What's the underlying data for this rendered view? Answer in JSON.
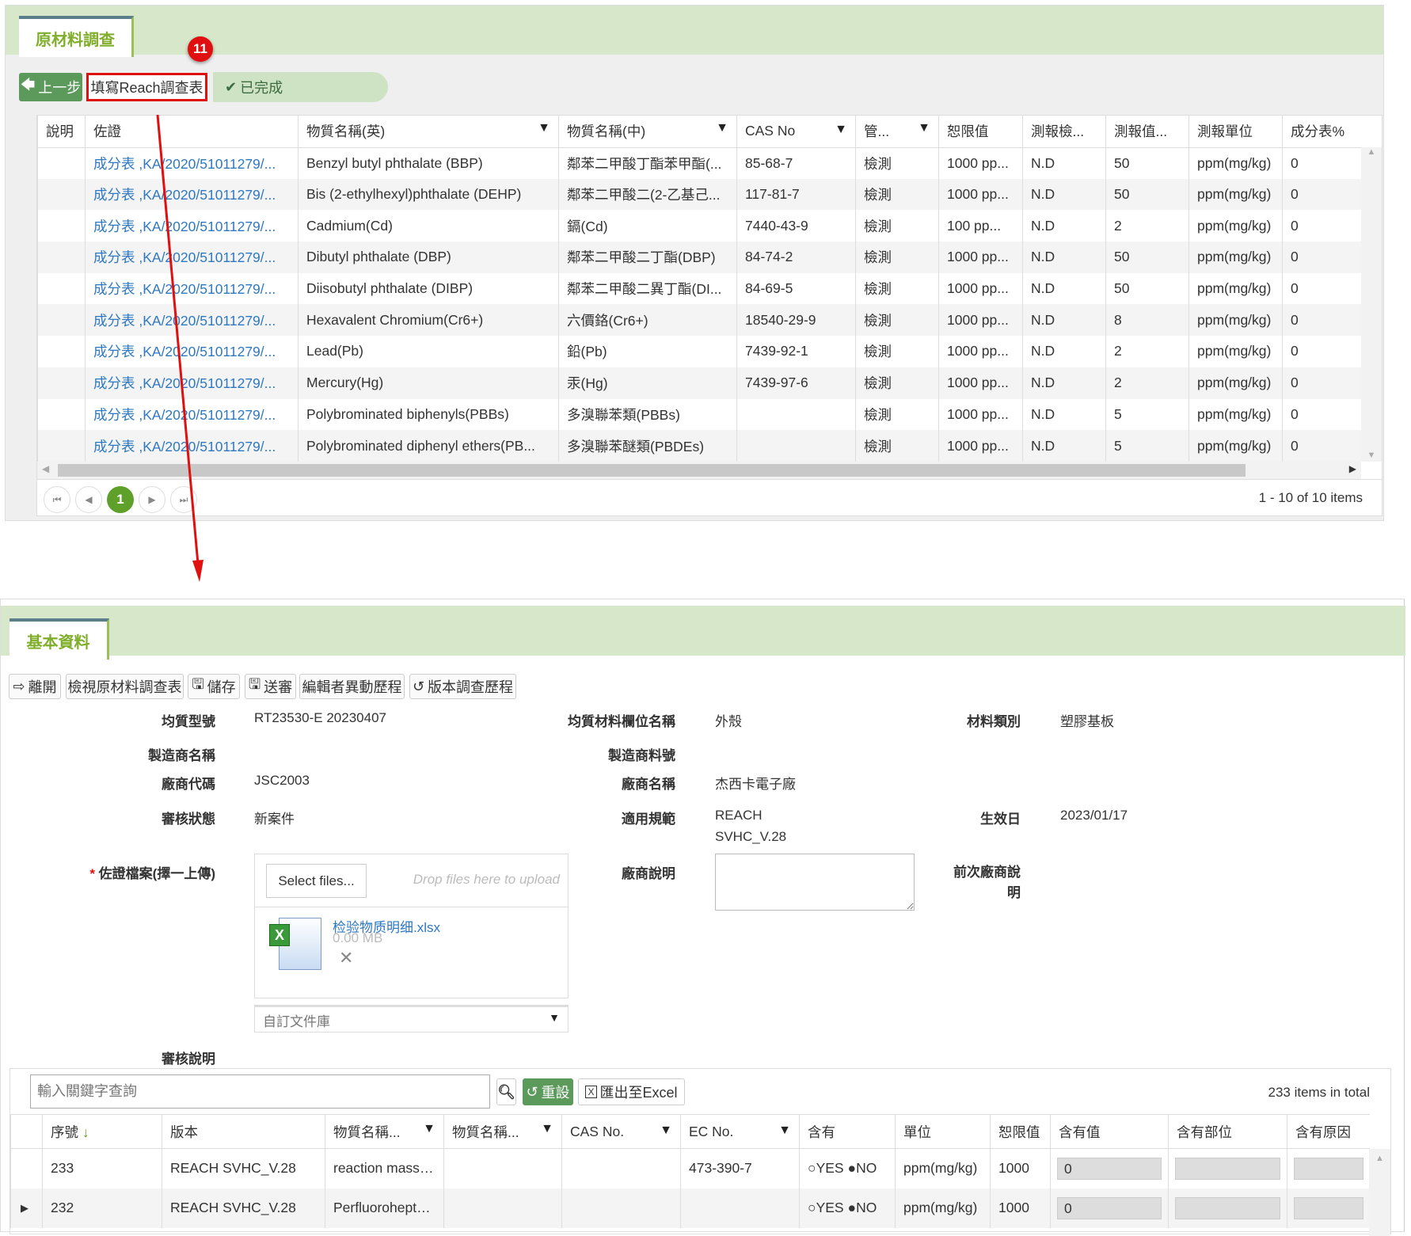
{
  "top": {
    "tab": "原材料調查",
    "badge": "11",
    "back_label": "上一步",
    "fill_label": "填寫Reach調查表",
    "done_label": "已完成",
    "columns": [
      "說明",
      "佐證",
      "物質名稱(英)",
      "物質名稱(中)",
      "CAS No",
      "管...",
      "恕限值",
      "測報檢...",
      "測報值...",
      "測報單位",
      "成分表%"
    ],
    "rows": [
      [
        "",
        "成分表 ,KA/2020/51011279/...",
        "Benzyl butyl phthalate (BBP)",
        "鄰苯二甲酸丁酯苯甲酯(...",
        "85-68-7",
        "檢測",
        "1000 pp...",
        "N.D",
        "50",
        "ppm(mg/kg)",
        "0"
      ],
      [
        "",
        "成分表 ,KA/2020/51011279/...",
        "Bis (2-ethylhexyl)phthalate (DEHP)",
        "鄰苯二甲酸二(2-乙基己...",
        "117-81-7",
        "檢測",
        "1000 pp...",
        "N.D",
        "50",
        "ppm(mg/kg)",
        "0"
      ],
      [
        "",
        "成分表 ,KA/2020/51011279/...",
        "Cadmium(Cd)",
        "鎘(Cd)",
        "7440-43-9",
        "檢測",
        "100 pp...",
        "N.D",
        "2",
        "ppm(mg/kg)",
        "0"
      ],
      [
        "",
        "成分表 ,KA/2020/51011279/...",
        "Dibutyl phthalate (DBP)",
        "鄰苯二甲酸二丁酯(DBP)",
        "84-74-2",
        "檢測",
        "1000 pp...",
        "N.D",
        "50",
        "ppm(mg/kg)",
        "0"
      ],
      [
        "",
        "成分表 ,KA/2020/51011279/...",
        "Diisobutyl phthalate (DIBP)",
        "鄰苯二甲酸二異丁酯(DI...",
        "84-69-5",
        "檢測",
        "1000 pp...",
        "N.D",
        "50",
        "ppm(mg/kg)",
        "0"
      ],
      [
        "",
        "成分表 ,KA/2020/51011279/...",
        "Hexavalent Chromium(Cr6+)",
        "六價鉻(Cr6+)",
        "18540-29-9",
        "檢測",
        "1000 pp...",
        "N.D",
        "8",
        "ppm(mg/kg)",
        "0"
      ],
      [
        "",
        "成分表 ,KA/2020/51011279/...",
        "Lead(Pb)",
        "鉛(Pb)",
        "7439-92-1",
        "檢測",
        "1000 pp...",
        "N.D",
        "2",
        "ppm(mg/kg)",
        "0"
      ],
      [
        "",
        "成分表 ,KA/2020/51011279/...",
        "Mercury(Hg)",
        "汞(Hg)",
        "7439-97-6",
        "檢測",
        "1000 pp...",
        "N.D",
        "2",
        "ppm(mg/kg)",
        "0"
      ],
      [
        "",
        "成分表 ,KA/2020/51011279/...",
        "Polybrominated biphenyls(PBBs)",
        "多溴聯苯類(PBBs)",
        "",
        "檢測",
        "1000 pp...",
        "N.D",
        "5",
        "ppm(mg/kg)",
        "0"
      ],
      [
        "",
        "成分表 ,KA/2020/51011279/...",
        "Polybrominated diphenyl ethers(PB...",
        "多溴聯苯醚類(PBDEs)",
        "",
        "檢測",
        "1000 pp...",
        "N.D",
        "5",
        "ppm(mg/kg)",
        "0"
      ]
    ],
    "pager": {
      "current": "1",
      "summary": "1 - 10 of 10 items"
    }
  },
  "bottom": {
    "tab": "基本資料",
    "toolbar": [
      "離開",
      "檢視原材料調查表",
      "儲存",
      "送審",
      "編輯者異動歷程",
      "版本調查歷程"
    ],
    "form": {
      "model_label": "均質型號",
      "model": "RT23530-E 20230407",
      "field_label": "均質材料欄位名稱",
      "field": "外殼",
      "category_label": "材料類別",
      "category": "塑膠基板",
      "mfr_name_label": "製造商名稱",
      "mfr_part_label": "製造商料號",
      "vendor_code_label": "廠商代碼",
      "vendor_code": "JSC2003",
      "vendor_name_label": "廠商名稱",
      "vendor_name": "杰西卡電子廠",
      "status_label": "審核狀態",
      "status": "新案件",
      "spec_label": "適用規範",
      "spec_line1": "REACH",
      "spec_line2": "SVHC_V.28",
      "effective_label": "生效日",
      "effective": "2023/01/17",
      "evidence_label": "佐證檔案(擇一上傳)",
      "select_files": "Select files...",
      "drop_hint": "Drop files here to upload",
      "file_name": "检验物质明细.xlsx",
      "file_size": "0.00 MB",
      "library": "自訂文件庫",
      "vendor_note_label": "廠商說明",
      "prev_note_label": "前次廠商說明",
      "review_note_label": "審核說明"
    },
    "grid": {
      "search_placeholder": "輸入關鍵字查詢",
      "reset": "重設",
      "export": "匯出至Excel",
      "total": "233 items in total",
      "columns": [
        "序號",
        "版本",
        "物質名稱...",
        "物質名稱...",
        "CAS No.",
        "EC No.",
        "含有",
        "單位",
        "恕限值",
        "含有值",
        "含有部位",
        "含有原因"
      ],
      "rows": [
        {
          "no": "233",
          "version": "REACH SVHC_V.28",
          "name_en": "reaction mass of :",
          "name_zh": "",
          "cas": "",
          "ec": "473-390-7",
          "yes": "YES",
          "no_opt": "NO",
          "unit": "ppm(mg/kg)",
          "limit": "1000",
          "value": "0",
          "part": "",
          "reason": ""
        },
        {
          "no": "232",
          "version": "REACH SVHC_V.28",
          "name_en": "Perfluoroheptano",
          "name_zh": "",
          "cas": "",
          "ec": "",
          "yes": "YES",
          "no_opt": "NO",
          "unit": "ppm(mg/kg)",
          "limit": "1000",
          "value": "0",
          "part": "",
          "reason": ""
        }
      ]
    }
  },
  "colors": {
    "band": "#d6e8c9",
    "tab_text": "#7fae2a",
    "button_green": "#5c9a5c",
    "link": "#2e78c2",
    "annotation_red": "#e01010"
  }
}
